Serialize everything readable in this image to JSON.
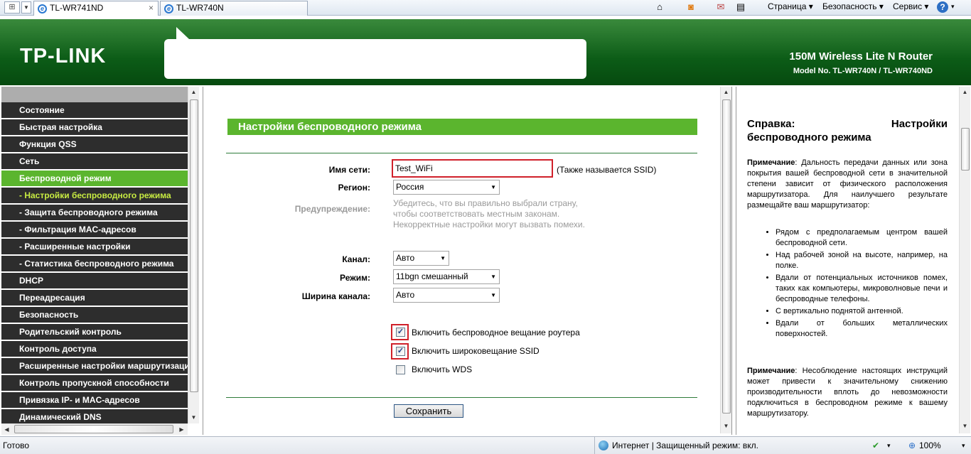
{
  "browser": {
    "tabs": [
      {
        "label": "TL-WR741ND",
        "active": true
      },
      {
        "label": "TL-WR740N",
        "active": false
      }
    ],
    "close_tab": "×",
    "commands": {
      "page": "Страница",
      "security": "Безопасность",
      "service": "Сервис",
      "help": "?"
    }
  },
  "banner": {
    "logo": "TP-LINK",
    "model_title": "150M Wireless Lite N Router",
    "model_number": "Model No. TL-WR740N / TL-WR740ND"
  },
  "menu": {
    "items": [
      {
        "label": "Состояние"
      },
      {
        "label": "Быстрая настройка"
      },
      {
        "label": "Функция QSS"
      },
      {
        "label": "Сеть"
      },
      {
        "label": "Беспроводной режим",
        "state": "active"
      },
      {
        "label": "- Настройки беспроводного режима",
        "state": "subactive"
      },
      {
        "label": "- Защита беспроводного режима"
      },
      {
        "label": "- Фильтрация MAC-адресов"
      },
      {
        "label": "- Расширенные настройки"
      },
      {
        "label": "- Статистика беспроводного режима"
      },
      {
        "label": "DHCP"
      },
      {
        "label": "Переадресация"
      },
      {
        "label": "Безопасность"
      },
      {
        "label": "Родительский контроль"
      },
      {
        "label": "Контроль доступа"
      },
      {
        "label": "Расширенные настройки маршрутизации"
      },
      {
        "label": "Контроль пропускной способности"
      },
      {
        "label": "Привязка IP- и MAC-адресов"
      },
      {
        "label": "Динамический DNS"
      }
    ]
  },
  "main": {
    "title": "Настройки беспроводного режима",
    "ssid_label": "Имя сети:",
    "ssid_value": "Test_WiFi",
    "ssid_note": "(Также называется SSID)",
    "region_label": "Регион:",
    "region_value": "Россия",
    "warning_label": "Предупреждение:",
    "warning_lines": [
      "Убедитесь, что вы правильно выбрали страну,",
      "чтобы соответствовать местным законам.",
      "Некорректные настройки могут вызвать помехи."
    ],
    "channel_label": "Канал:",
    "channel_value": "Авто",
    "mode_label": "Режим:",
    "mode_value": "11bgn смешанный",
    "width_label": "Ширина канала:",
    "width_value": "Авто",
    "checkboxes": [
      {
        "label": "Включить беспроводное вещание роутера",
        "checked": true
      },
      {
        "label": "Включить широковещание SSID",
        "checked": true
      },
      {
        "label": "Включить WDS",
        "checked": false
      }
    ],
    "save_label": "Сохранить"
  },
  "help": {
    "title_left": "Справка:",
    "title_right": "Настройки",
    "title_line2": "беспроводного режима",
    "note_label": "Примечание",
    "note1": ": Дальность передачи данных или зона покрытия вашей беспроводной сети в значительной степени зависит от физического расположения маршрутизатора. Для наилучшего результате размещайте ваш маршрутизатор:",
    "bullets": [
      "Рядом с предполагаемым центром вашей беспроводной сети.",
      "Над рабочей зоной на высоте, например, на полке.",
      "Вдали от потенциальных источников помех, таких как компьютеры, микроволновые печи и беспроводные телефоны.",
      "С вертикально поднятой антенной.",
      "Вдали от больших металлических поверхностей."
    ],
    "note2": ":      Несоблюдение настоящих инструкций может привести к значительному снижению производительности вплоть до невозможности подключиться в беспроводном режиме к вашему маршрутизатору."
  },
  "status": {
    "ready": "Готово",
    "zone": "Интернет | Защищенный режим: вкл.",
    "zoom": "100%"
  },
  "colors": {
    "accent": "#5bb52e",
    "menu_bg": "#2d2d2d",
    "banner": "#0c5c17",
    "highlight": "#d0202a"
  }
}
